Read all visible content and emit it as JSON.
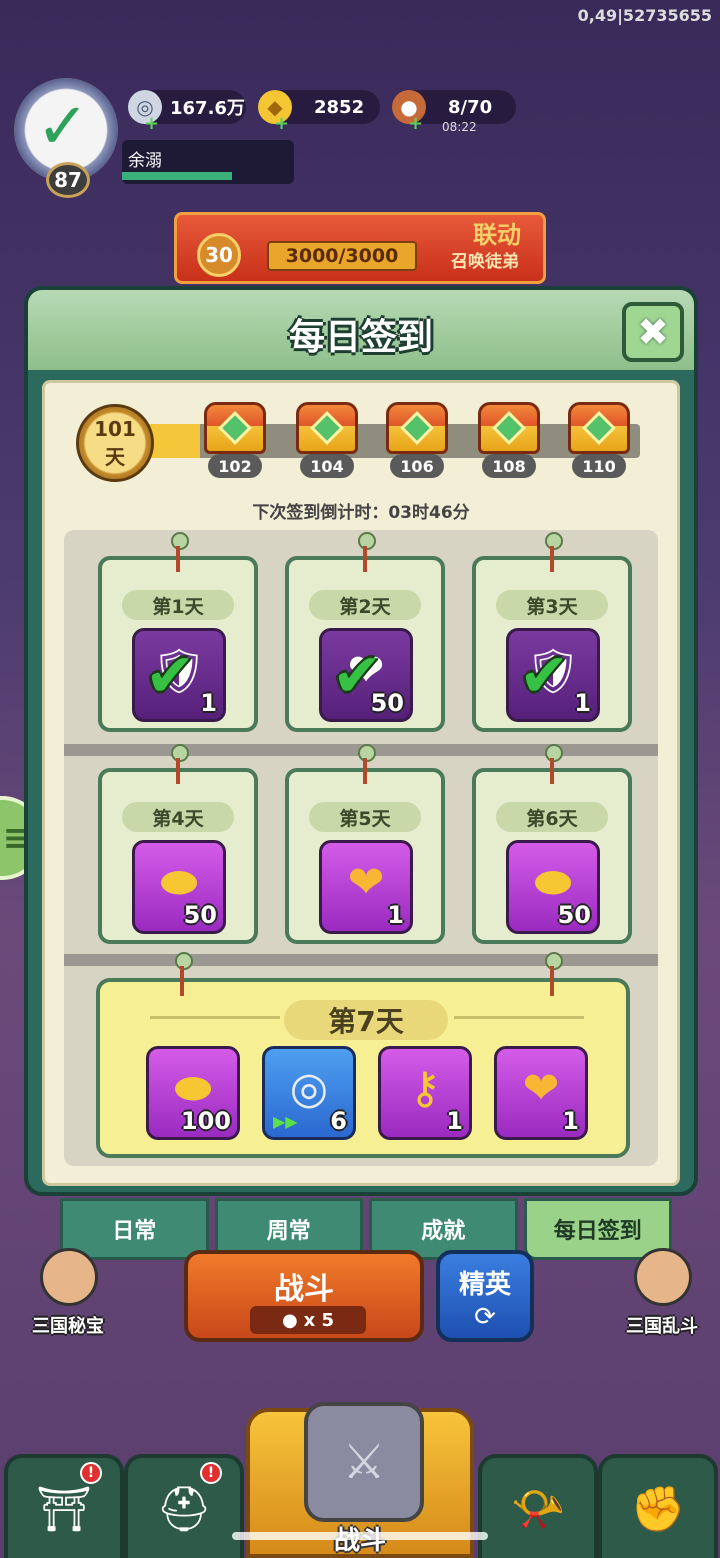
{
  "debug_text": "0,49|52735655",
  "player": {
    "level": "87",
    "name": "余溺"
  },
  "resources": {
    "coins": "167.6万",
    "ingots": "2852",
    "stamina": "8/70",
    "stamina_timer": "08:22"
  },
  "event": {
    "level": "30",
    "progress": "3000/3000",
    "tag": "联动",
    "subtitle": "召唤徒弟"
  },
  "dialog": {
    "title": "每日签到",
    "close_icon": "close-icon",
    "streak": {
      "days": "101",
      "unit": "天",
      "progress": 0.04
    },
    "milestones": [
      "102",
      "104",
      "106",
      "108",
      "110"
    ],
    "countdown": "下次签到倒计时：03时46分",
    "days": [
      {
        "label": "第1天",
        "icon": "emblem",
        "qty": "1",
        "claimed": true
      },
      {
        "label": "第2天",
        "icon": "heart-token",
        "qty": "50",
        "claimed": true
      },
      {
        "label": "第3天",
        "icon": "emblem",
        "qty": "1",
        "claimed": true
      },
      {
        "label": "第4天",
        "icon": "gold-ingot",
        "qty": "50",
        "claimed": false
      },
      {
        "label": "第5天",
        "icon": "heart-coin",
        "qty": "1",
        "claimed": false
      },
      {
        "label": "第6天",
        "icon": "gold-ingot",
        "qty": "50",
        "claimed": false
      }
    ],
    "day7": {
      "label": "第7天",
      "rewards": [
        {
          "icon": "gold-ingot",
          "qty": "100"
        },
        {
          "icon": "silver-coin",
          "qty": "6"
        },
        {
          "icon": "golden-key",
          "qty": "1"
        },
        {
          "icon": "heart-coin",
          "qty": "1"
        }
      ]
    }
  },
  "tabs": [
    {
      "label": "日常",
      "active": false
    },
    {
      "label": "周常",
      "active": false
    },
    {
      "label": "成就",
      "active": false
    },
    {
      "label": "每日签到",
      "active": true
    }
  ],
  "battle": {
    "label": "战斗",
    "cost": "x 5",
    "elite_label": "精英"
  },
  "side_chars": {
    "left": "三国秘宝",
    "right": "三国乱斗"
  },
  "nav": {
    "center_label": "战斗",
    "badge": "!"
  }
}
